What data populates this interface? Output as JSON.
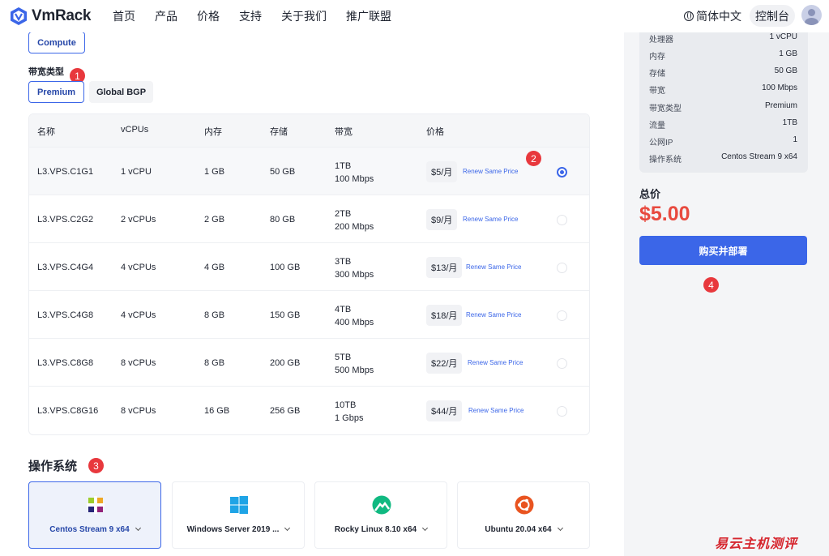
{
  "brand": {
    "name": "VmRack",
    "color": "#3b66e8"
  },
  "nav": {
    "items": [
      "首页",
      "产品",
      "价格",
      "支持",
      "关于我们",
      "推广联盟"
    ]
  },
  "header": {
    "language": "简体中文",
    "console": "控制台"
  },
  "category": {
    "selected": "Compute"
  },
  "bandwidth": {
    "label": "带宽类型",
    "options": [
      "Premium",
      "Global BGP"
    ],
    "selected": "Premium"
  },
  "table": {
    "headers": [
      "名称",
      "vCPUs",
      "内存",
      "存储",
      "带宽",
      "价格"
    ],
    "renew_label": "Renew Same Price",
    "rows": [
      {
        "name": "L3.VPS.C1G1",
        "cpu": "1 vCPU",
        "mem": "1 GB",
        "disk": "50 GB",
        "traffic": "1TB",
        "speed": "100 Mbps",
        "price": "$5/月",
        "selected": true
      },
      {
        "name": "L3.VPS.C2G2",
        "cpu": "2 vCPUs",
        "mem": "2 GB",
        "disk": "80 GB",
        "traffic": "2TB",
        "speed": "200 Mbps",
        "price": "$9/月",
        "selected": false
      },
      {
        "name": "L3.VPS.C4G4",
        "cpu": "4 vCPUs",
        "mem": "4 GB",
        "disk": "100 GB",
        "traffic": "3TB",
        "speed": "300 Mbps",
        "price": "$13/月",
        "selected": false
      },
      {
        "name": "L3.VPS.C4G8",
        "cpu": "4 vCPUs",
        "mem": "8 GB",
        "disk": "150 GB",
        "traffic": "4TB",
        "speed": "400 Mbps",
        "price": "$18/月",
        "selected": false
      },
      {
        "name": "L3.VPS.C8G8",
        "cpu": "8 vCPUs",
        "mem": "8 GB",
        "disk": "200 GB",
        "traffic": "5TB",
        "speed": "500 Mbps",
        "price": "$22/月",
        "selected": false
      },
      {
        "name": "L3.VPS.C8G16",
        "cpu": "8 vCPUs",
        "mem": "16 GB",
        "disk": "256 GB",
        "traffic": "10TB",
        "speed": "1 Gbps",
        "price": "$44/月",
        "selected": false
      }
    ]
  },
  "os": {
    "title": "操作系统",
    "options": [
      {
        "name": "Centos Stream 9 x64",
        "icon": "centos-logo-icon",
        "selected": true
      },
      {
        "name": "Windows Server 2019 ...",
        "icon": "windows-logo-icon",
        "selected": false
      },
      {
        "name": "Rocky Linux 8.10 x64",
        "icon": "rocky-linux-logo-icon",
        "selected": false
      },
      {
        "name": "Ubuntu 20.04 x64",
        "icon": "ubuntu-logo-icon",
        "selected": false
      }
    ]
  },
  "summary": {
    "specs": [
      {
        "key": "处理器",
        "value": "1 vCPU"
      },
      {
        "key": "内存",
        "value": "1 GB"
      },
      {
        "key": "存储",
        "value": "50 GB"
      },
      {
        "key": "带宽",
        "value": "100 Mbps"
      },
      {
        "key": "带宽类型",
        "value": "Premium"
      },
      {
        "key": "流量",
        "value": "1TB"
      },
      {
        "key": "公网IP",
        "value": "1"
      },
      {
        "key": "操作系统",
        "value": "Centos Stream 9 x64"
      }
    ],
    "total_label": "总价",
    "total_price": "$5.00",
    "buy_label": "购买并部署",
    "price_color": "#e84a3f"
  },
  "annotations": [
    "1",
    "2",
    "3",
    "4"
  ],
  "watermark": "易云主机测评"
}
